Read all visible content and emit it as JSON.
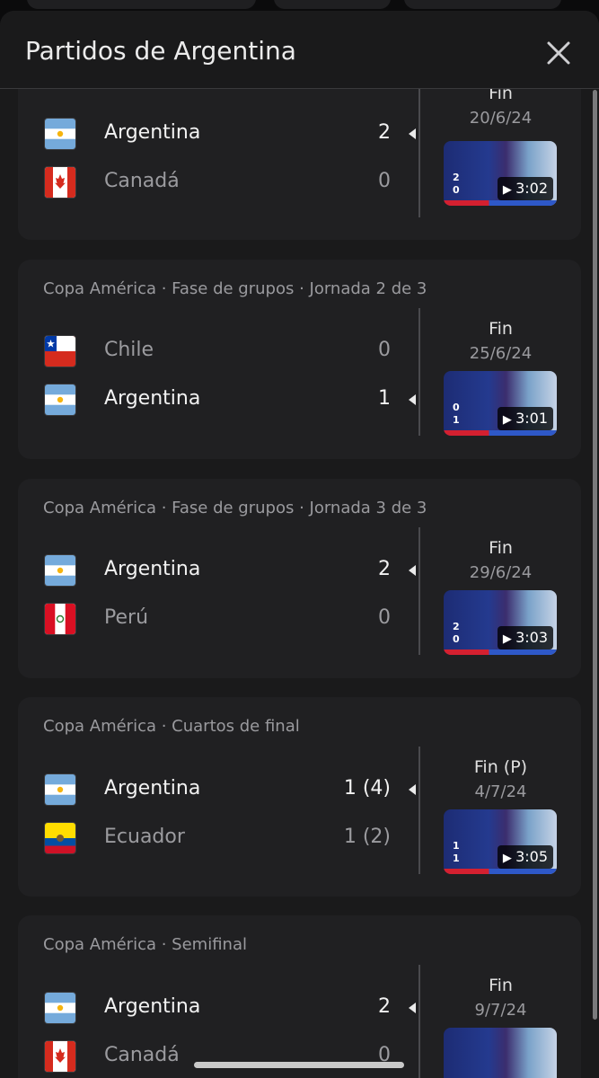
{
  "sheet": {
    "title": "Partidos de Argentina"
  },
  "matches": [
    {
      "competition": "",
      "teams": [
        {
          "name": "Argentina",
          "score": "2",
          "flag": "argentina-flag",
          "winner": true
        },
        {
          "name": "Canadá",
          "score": "0",
          "flag": "canada-flag",
          "winner": false
        }
      ],
      "status": "Fin",
      "date": "20/6/24",
      "duration": "3:02",
      "thumb_scores": [
        "2",
        "0"
      ]
    },
    {
      "competition": "Copa América · Fase de grupos · Jornada 2 de 3",
      "teams": [
        {
          "name": "Chile",
          "score": "0",
          "flag": "chile-flag",
          "winner": false
        },
        {
          "name": "Argentina",
          "score": "1",
          "flag": "argentina-flag",
          "winner": true
        }
      ],
      "status": "Fin",
      "date": "25/6/24",
      "duration": "3:01",
      "thumb_scores": [
        "0",
        "1"
      ]
    },
    {
      "competition": "Copa América · Fase de grupos · Jornada 3 de 3",
      "teams": [
        {
          "name": "Argentina",
          "score": "2",
          "flag": "argentina-flag",
          "winner": true
        },
        {
          "name": "Perú",
          "score": "0",
          "flag": "peru-flag",
          "winner": false
        }
      ],
      "status": "Fin",
      "date": "29/6/24",
      "duration": "3:03",
      "thumb_scores": [
        "2",
        "0"
      ]
    },
    {
      "competition": "Copa América · Cuartos de final",
      "teams": [
        {
          "name": "Argentina",
          "score": "1 (4)",
          "flag": "argentina-flag",
          "winner": true
        },
        {
          "name": "Ecuador",
          "score": "1 (2)",
          "flag": "ecuador-flag",
          "winner": false
        }
      ],
      "status": "Fin (P)",
      "date": "4/7/24",
      "duration": "3:05",
      "thumb_scores": [
        "1",
        "1"
      ]
    },
    {
      "competition": "Copa América · Semifinal",
      "teams": [
        {
          "name": "Argentina",
          "score": "2",
          "flag": "argentina-flag",
          "winner": true
        },
        {
          "name": "Canadá",
          "score": "0",
          "flag": "canada-flag",
          "winner": false
        }
      ],
      "status": "Fin",
      "date": "9/7/24",
      "duration": "",
      "thumb_scores": []
    }
  ],
  "colors": {
    "background": "#1a1a1b",
    "card": "#202022",
    "winner_text": "#f2f2f2",
    "loser_text": "#9b9b9f"
  },
  "icons": {
    "close": "close-icon",
    "play": "play-icon"
  }
}
